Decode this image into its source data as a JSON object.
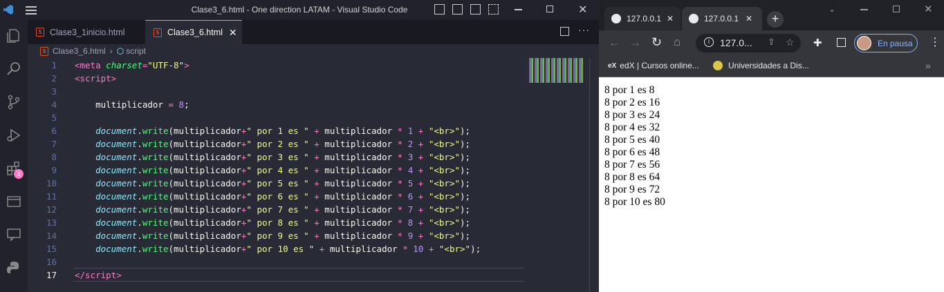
{
  "vscode": {
    "window_title": "Clase3_6.html - One direction LATAM - Visual Studio Code",
    "tabs": [
      {
        "label": "Clase3_1inicio.html",
        "active": false
      },
      {
        "label": "Clase3_6.html",
        "active": true
      }
    ],
    "breadcrumb": {
      "file": "Clase3_6.html",
      "symbol": "script"
    },
    "extensions_badge": "2",
    "line_numbers": [
      "1",
      "2",
      "3",
      "4",
      "5",
      "6",
      "7",
      "8",
      "9",
      "10",
      "11",
      "12",
      "13",
      "14",
      "15",
      "16",
      "17"
    ],
    "current_line": "17"
  },
  "chrome": {
    "tabs": [
      {
        "label": "127.0.0.1",
        "active": false
      },
      {
        "label": "127.0.0.1",
        "active": true
      }
    ],
    "address": "127.0...",
    "profile_label": "En pausa",
    "bookmarks": [
      {
        "label": "edX | Cursos online..."
      },
      {
        "label": "Universidades a Dis..."
      }
    ],
    "output_lines": [
      "8 por 1 es 8",
      "8 por 2 es 16",
      "8 por 3 es 24",
      "8 por 4 es 32",
      "8 por 5 es 40",
      "8 por 6 es 48",
      "8 por 7 es 56",
      "8 por 8 es 64",
      "8 por 9 es 72",
      "8 por 10 es 80"
    ]
  }
}
